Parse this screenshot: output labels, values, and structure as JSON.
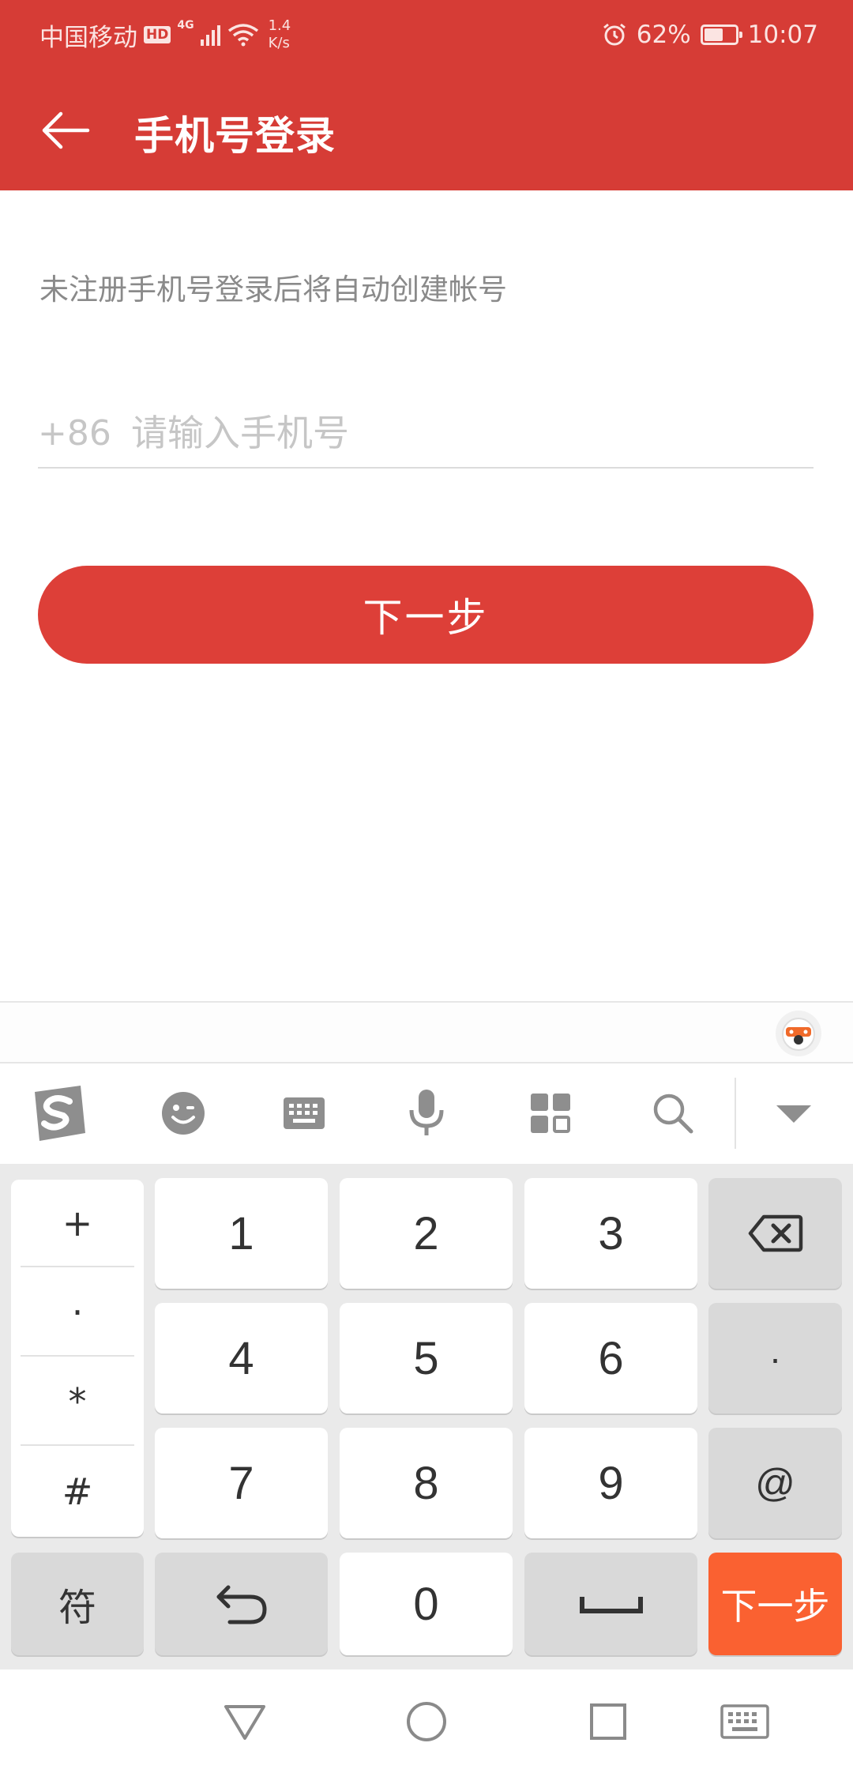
{
  "status_bar": {
    "carrier": "中国移动",
    "hd": "HD",
    "network": "4G",
    "speed_value": "1.4",
    "speed_unit": "K/s",
    "battery": "62%",
    "battery_level": 0.62,
    "time": "10:07"
  },
  "header": {
    "title": "手机号登录",
    "back_icon": "arrow-left-icon",
    "background": "#d63c36"
  },
  "form": {
    "hint": "未注册手机号登录后将自动创建帐号",
    "country_code": "+86",
    "phone_placeholder": "请输入手机号",
    "phone_value": "",
    "next_label": "下一步"
  },
  "keyboard": {
    "toolbar_icons": [
      "sogou-logo-icon",
      "emoji-icon",
      "keyboard-icon",
      "microphone-icon",
      "apps-grid-icon",
      "search-icon",
      "collapse-icon"
    ],
    "symbols": [
      "+",
      "·",
      "*",
      "#"
    ],
    "digits": [
      "1",
      "2",
      "3",
      "4",
      "5",
      "6",
      "7",
      "8",
      "9",
      "0"
    ],
    "right_keys": [
      "·",
      "@"
    ],
    "fu_label": "符",
    "enter_label": "下一步",
    "accent": "#fa6131"
  },
  "nav_bar": {
    "icons": [
      "back-triangle-icon",
      "home-circle-icon",
      "recents-square-icon",
      "keyboard-hide-icon"
    ]
  }
}
